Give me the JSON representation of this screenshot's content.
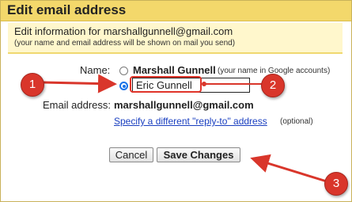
{
  "dialog": {
    "title": "Edit email address",
    "info_heading": "Edit information for marshallgunnell@gmail.com",
    "info_note": "(your name and email address will be shown on mail you send)"
  },
  "form": {
    "name_label": "Name:",
    "option_account_name": "Marshall Gunnell",
    "option_account_note": "(your name in Google accounts)",
    "custom_name_value": "Eric Gunnell",
    "email_label": "Email address:",
    "email_value": "marshallgunnell@gmail.com",
    "reply_to_link": "Specify a different \"reply-to\" address",
    "reply_to_note": "(optional)"
  },
  "buttons": {
    "cancel": "Cancel",
    "save": "Save Changes"
  },
  "annotations": {
    "markers": [
      "1",
      "2",
      "3"
    ],
    "color": "#d9362b"
  }
}
